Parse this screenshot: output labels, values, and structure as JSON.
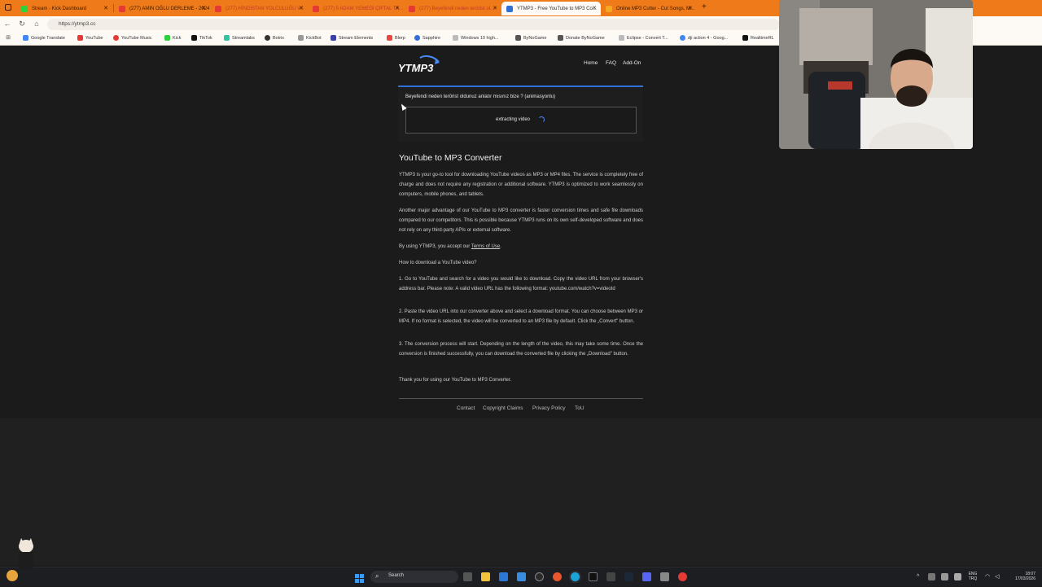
{
  "browser": {
    "tabs": [
      {
        "label": "Stream - Kick Dashboard",
        "color": "#2bd23c"
      },
      {
        "label": "(277) AMIN OĞLU DERLEME - 2024",
        "color": "#e53935"
      },
      {
        "label": "(277) HİNDİSTAN YOLCULUĞU V...",
        "color": "#e53935"
      },
      {
        "label": "(277) 5 ADAM YEMEĞİ ÇİFTAL TA...",
        "color": "#e53935"
      },
      {
        "label": "(277) Beyefendi neden terörist ol...",
        "color": "#e53935"
      },
      {
        "label": "YTMP3 - Free YouTube to MP3 Co...",
        "color": "#2f6fd6"
      },
      {
        "label": "Online MP3 Cutter - Cut Songs, M...",
        "color": "#f5a623"
      }
    ],
    "new_tab": "+",
    "url": "https://ytmp3.cc",
    "bookmarks": [
      "Google Translate",
      "YouTube",
      "YouTube Music",
      "Kick",
      "TikTok",
      "Streamlabs",
      "Botrix",
      "KickBot",
      "Stream Elements",
      "Blerp",
      "Sapphire",
      "Windows 10 high...",
      "ByNoGame",
      "Donate ByNoGame",
      "Eclipse - Convert T...",
      "dji action 4 - Goog...",
      "RealtimeRL"
    ]
  },
  "site": {
    "logo": "YTMP3",
    "nav": [
      "Home",
      "FAQ",
      "Add-On"
    ],
    "video_title": "Beyefendi neden terörist oldunuz anlatır mısınız bize ? (animasyonlu)",
    "status": "extracting video",
    "heading": "YouTube to MP3 Converter",
    "p1": "YTMP3 is your go-to tool for downloading YouTube videos as MP3 or MP4 files. The service is completely free of charge and does not require any registration or additional software. YTMP3 is optimized to work seamlessly on computers, mobile phones, and tablets.",
    "p2": "Another major advantage of our YouTube to MP3 converter is faster conversion times and safe file downloads compared to our competitors. This is possible because YTMP3 runs on its own self-developed software and does not rely on any third-party APIs or external software.",
    "p3_prefix": "By using YTMP3, you accept our",
    "p3_link": "Terms of Use",
    "p3_suffix": ".",
    "p4": "How to download a YouTube video?",
    "step1": "1. Go to YouTube and search for a video you would like to download. Copy the video URL from your browser's address bar. Please note: A valid video URL has the following format: youtube.com/watch?v=videoId",
    "step2": "2. Paste the video URL into our converter above and select a download format. You can choose between MP3 or MP4. If no format is selected, the video will be converted to an MP3 file by default. Click the „Convert\" button.",
    "step3": "3. The conversion process will start. Depending on the length of the video, this may take some time. Once the conversion is finished successfully, you can download the converted file by clicking the „Download\" button.",
    "thanks": "Thank you for using our YouTube to MP3 Converter.",
    "footer": [
      "Contact",
      "Copyright Claims",
      "Privacy Policy",
      "ToU"
    ]
  },
  "taskbar": {
    "search": "Search",
    "lang": "ENG",
    "region": "TRQ",
    "time": "18:07",
    "date": "17/03/2026"
  },
  "colors": {
    "accent_blue": "#2f6fd6",
    "tabbar_orange": "#ef7a1a"
  }
}
